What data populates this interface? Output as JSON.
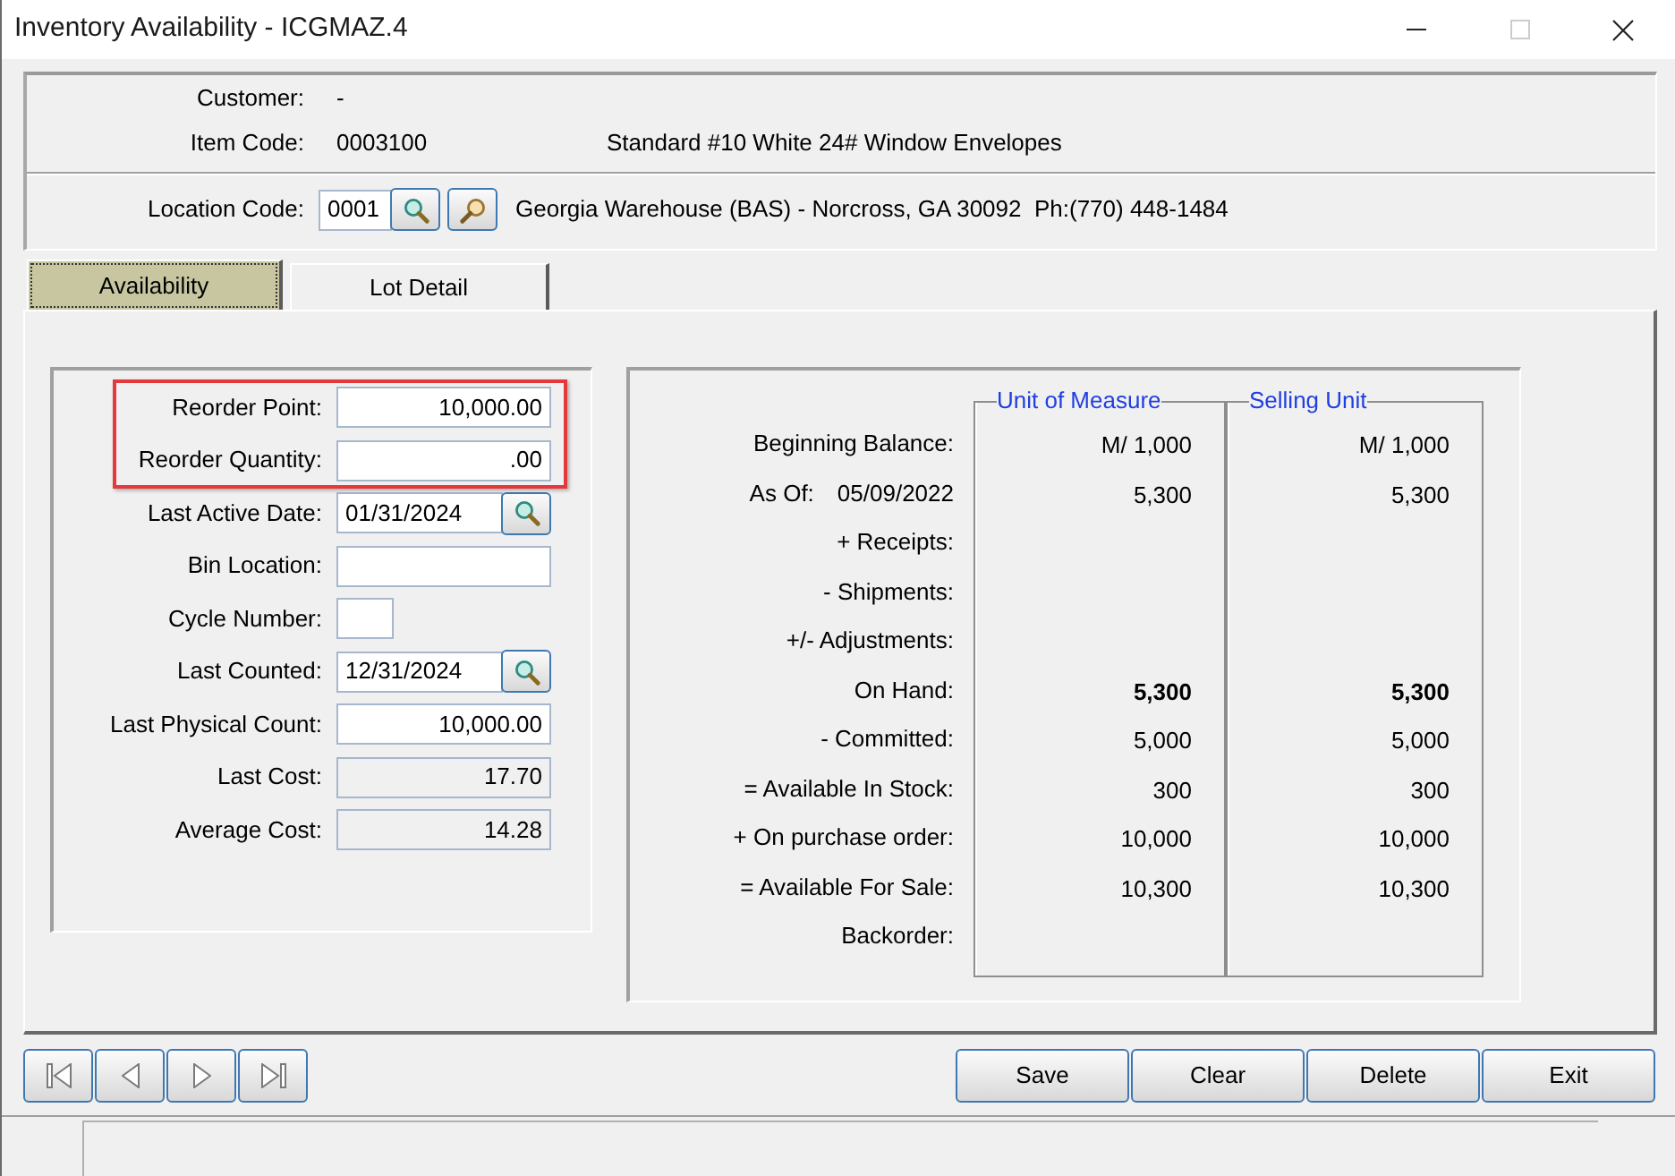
{
  "window": {
    "title": "Inventory Availability - ICGMAZ.4",
    "maximize": {
      "disabled": true
    }
  },
  "header": {
    "customer_label": "Customer:",
    "customer": "-",
    "item_code_label": "Item Code:",
    "item_code": "0003100",
    "item_description": "Standard #10 White 24# Window Envelopes"
  },
  "location": {
    "label": "Location Code:",
    "code": "0001",
    "description": "Georgia Warehouse (BAS) - Norcross, GA 30092  Ph:(770) 448-1484"
  },
  "tabs": [
    {
      "label": "Availability",
      "selected": true
    },
    {
      "label": "Lot Detail",
      "selected": false
    }
  ],
  "fields": [
    {
      "label": "Reorder Point:",
      "value": "10,000.00",
      "kind": "number",
      "highlighted": true
    },
    {
      "label": "Reorder Quantity:",
      "value": ".00",
      "kind": "number",
      "highlighted": true
    },
    {
      "label": "Last Active Date:",
      "value": "01/31/2024",
      "kind": "date",
      "highlighted": false
    },
    {
      "label": "Bin Location:",
      "kind": "text",
      "highlighted": false
    },
    {
      "label": "Cycle Number:",
      "kind": "short",
      "highlighted": false
    },
    {
      "label": "Last Counted:",
      "value": "12/31/2024",
      "kind": "date",
      "highlighted": false
    },
    {
      "label": "Last Physical Count:",
      "value": "10,000.00",
      "kind": "number",
      "highlighted": false
    },
    {
      "label": "Last Cost:",
      "value": "17.70",
      "kind": "readonly",
      "highlighted": false
    },
    {
      "label": "Average Cost:",
      "value": "14.28",
      "kind": "readonly",
      "highlighted": false
    }
  ],
  "balances": {
    "columns": [
      "Unit of Measure",
      "Selling Unit"
    ],
    "rows": [
      {
        "label": "Beginning Balance:",
        "values": [
          "M/ 1,000",
          "M/ 1,000"
        ],
        "emphasized": false
      },
      {
        "label": "As Of:",
        "date": "05/09/2022",
        "values": [
          "5,300",
          "5,300"
        ],
        "emphasized": false
      },
      {
        "label": "+ Receipts:"
      },
      {
        "label": "- Shipments:"
      },
      {
        "label": "+/- Adjustments:"
      },
      {
        "label": "On Hand:",
        "values": [
          "5,300",
          "5,300"
        ],
        "emphasized": true
      },
      {
        "label": "- Committed:",
        "values": [
          "5,000",
          "5,000"
        ],
        "emphasized": false
      },
      {
        "label": "= Available In Stock:",
        "values": [
          "300",
          "300"
        ],
        "emphasized": false
      },
      {
        "label": "+ On purchase order:",
        "values": [
          "10,000",
          "10,000"
        ],
        "emphasized": false
      },
      {
        "label": "= Available For Sale:",
        "values": [
          "10,300",
          "10,300"
        ],
        "emphasized": false
      },
      {
        "label": "Backorder:"
      }
    ]
  },
  "buttons": [
    "Save",
    "Clear",
    "Delete",
    "Exit"
  ]
}
